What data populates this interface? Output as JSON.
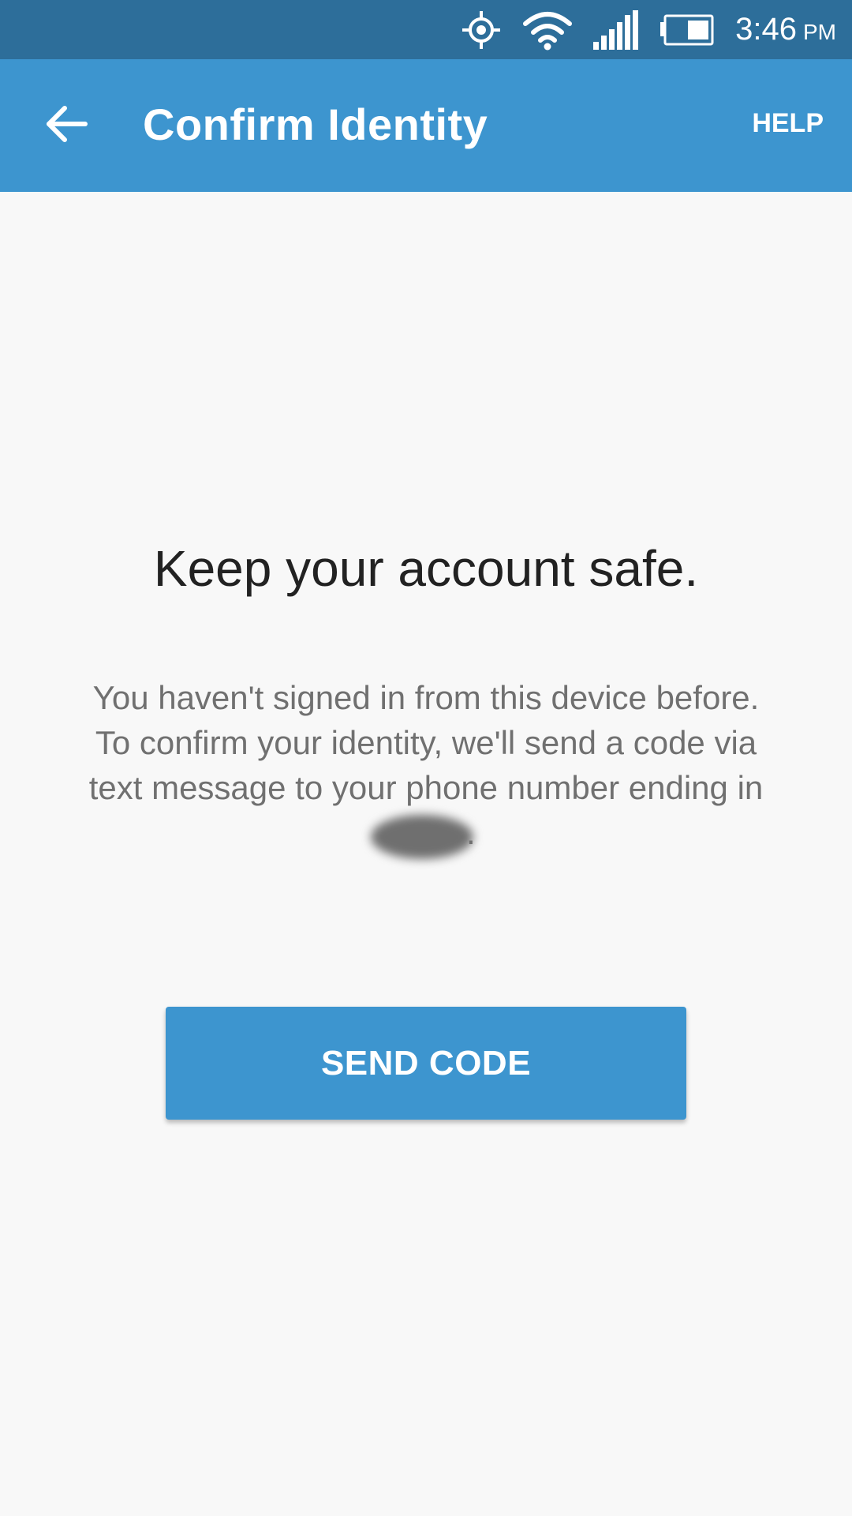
{
  "status_bar": {
    "icons": [
      "gps-icon",
      "wifi-icon",
      "signal-icon",
      "battery-icon"
    ],
    "time": "3:46",
    "ampm": "PM",
    "background": "#2d6e9a"
  },
  "app_bar": {
    "back_icon": "arrow-left-icon",
    "title": "Confirm Identity",
    "help_label": "HELP",
    "background": "#3d95cf"
  },
  "main": {
    "headline": "Keep your account safe.",
    "message_lines": [
      "You haven't signed in from this device before.",
      "To confirm your identity, we'll send a code via",
      "text message to your phone number ending in"
    ],
    "message_end": ".",
    "send_button_label": "SEND CODE"
  },
  "colors": {
    "accent": "#3d95cf",
    "background": "#f8f8f8",
    "headline_text": "#222222",
    "body_text": "#707070"
  }
}
